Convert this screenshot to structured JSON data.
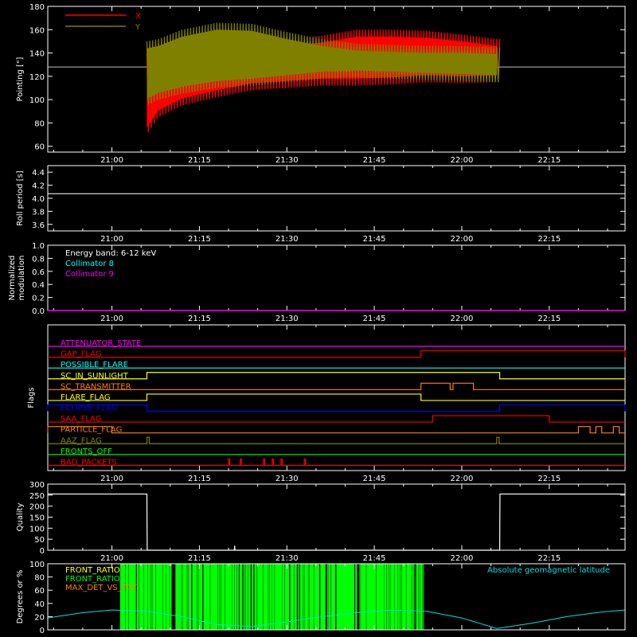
{
  "time_axis": {
    "tick_labels": [
      "21:00",
      "21:15",
      "21:30",
      "21:45",
      "22:00",
      "22:15"
    ],
    "tick_minutes": [
      0,
      15,
      30,
      45,
      60,
      75
    ],
    "range_minutes": [
      -11,
      88
    ],
    "data_start_minute": 6,
    "data_end_minute": 66.5
  },
  "colors": {
    "axis": "#ffffff",
    "x_series": "#ff0000",
    "y_series": "#808000",
    "collimator8": "#00ffff",
    "collimator9": "#ff00ff",
    "quality": "#ffffff",
    "front_ratio": "#00ff00",
    "latitude": "#00e0e0"
  },
  "chart_data": [
    {
      "id": "pointing",
      "type": "line",
      "ylabel": "Pointing [\"]",
      "ylim": [
        55,
        180
      ],
      "yticks": [
        60,
        80,
        100,
        120,
        140,
        160,
        180
      ],
      "reference_line": 128,
      "legend": [
        {
          "name": "X",
          "color": "#ff0000"
        },
        {
          "name": "Y",
          "color": "#808000"
        }
      ],
      "envelopes": [
        {
          "name": "X",
          "color": "#ff0000",
          "x": [
            6,
            8,
            12,
            18,
            24,
            30,
            36,
            42,
            48,
            54,
            60,
            66
          ],
          "upper": [
            140,
            148,
            150,
            152,
            150,
            152,
            155,
            160,
            160,
            159,
            156,
            152
          ],
          "lower": [
            70,
            85,
            95,
            102,
            108,
            110,
            112,
            112,
            113,
            115,
            114,
            115
          ]
        },
        {
          "name": "Y",
          "color": "#808000",
          "x": [
            6,
            8,
            12,
            18,
            24,
            30,
            36,
            42,
            48,
            54,
            60,
            66
          ],
          "upper": [
            150,
            152,
            160,
            166,
            165,
            158,
            152,
            148,
            147,
            146,
            146,
            145
          ],
          "lower": [
            95,
            100,
            105,
            110,
            112,
            115,
            118,
            119,
            118,
            117,
            116,
            115
          ]
        }
      ]
    },
    {
      "id": "roll_period",
      "type": "line",
      "ylabel": "Roll period [s]",
      "ylim": [
        3.5,
        4.5
      ],
      "yticks": [
        3.6,
        3.8,
        4.0,
        4.2,
        4.4
      ],
      "x": [
        -11,
        88
      ],
      "values": [
        4.07,
        4.07
      ]
    },
    {
      "id": "modulation",
      "type": "line",
      "ylabel": "Normalized modulation",
      "ylim": [
        0,
        1
      ],
      "yticks": [
        0.0,
        0.2,
        0.4,
        0.6,
        0.8,
        1.0
      ],
      "legend": [
        {
          "name": "Energy band: 6-12 keV",
          "color": "#ffffff"
        },
        {
          "name": "Collimator 8",
          "color": "#00ffff"
        },
        {
          "name": "Collimator 9",
          "color": "#ff00ff"
        }
      ],
      "x": [
        -11,
        88
      ],
      "values": [
        0,
        0
      ]
    },
    {
      "id": "flags",
      "type": "line",
      "ylabel": "Flags",
      "flags": [
        {
          "name": "ATTENUATOR_STATE",
          "color": "#ff00ff",
          "segments": []
        },
        {
          "name": "GAP_FLAG",
          "color": "#ff0000",
          "segments": [
            [
              53,
              88
            ]
          ]
        },
        {
          "name": "POSSIBLE_FLARE",
          "color": "#00ffff",
          "segments": []
        },
        {
          "name": "SC_IN_SUNLIGHT",
          "color": "#ffff00",
          "segments": [
            [
              6,
              66.5
            ]
          ]
        },
        {
          "name": "SC_TRANSMITTER",
          "color": "#ff8000",
          "segments": [
            [
              53,
              58
            ],
            [
              58.5,
              62
            ]
          ]
        },
        {
          "name": "FLARE_FLAG",
          "color": "#ffff00",
          "segments": [
            [
              6,
              53
            ]
          ]
        },
        {
          "name": "ECLIPSE_FLAG",
          "color": "#0000ff",
          "segments": [
            [
              -11,
              6
            ],
            [
              66.5,
              88
            ]
          ]
        },
        {
          "name": "SAA_FLAG",
          "color": "#ff0000",
          "segments": [
            [
              55,
              75
            ]
          ]
        },
        {
          "name": "PARTICLE_FLAG",
          "color": "#ff8000",
          "segments": [
            [
              -11,
              0
            ],
            [
              80,
              82
            ],
            [
              83,
              84
            ],
            [
              86,
              87
            ]
          ]
        },
        {
          "name": "AAZ_FLAG",
          "color": "#808000",
          "segments": [
            [
              6,
              6.4
            ],
            [
              66,
              66.4
            ]
          ]
        },
        {
          "name": "FRONTS_OFF",
          "color": "#00ff00",
          "segments": []
        },
        {
          "name": "BAD_PACKETS",
          "color": "#ff0000",
          "segments": [
            [
              20,
              20.2
            ],
            [
              22,
              22.2
            ],
            [
              26,
              26.2
            ],
            [
              27.5,
              27.7
            ],
            [
              29,
              29.2
            ],
            [
              33,
              33.2
            ]
          ]
        }
      ]
    },
    {
      "id": "quality",
      "type": "line",
      "ylabel": "Quality",
      "ylim": [
        0,
        300
      ],
      "yticks": [
        0,
        50,
        100,
        150,
        200,
        250,
        300
      ],
      "x": [
        -11,
        6,
        6.05,
        21,
        21.05,
        21.1,
        66.5,
        66.55,
        88
      ],
      "values": [
        255,
        255,
        0,
        0,
        20,
        0,
        0,
        255,
        255
      ]
    },
    {
      "id": "front_ratio",
      "type": "area",
      "ylabel": "Degrees or %",
      "ylim": [
        0,
        100
      ],
      "yticks": [
        0,
        20,
        40,
        60,
        80,
        100
      ],
      "legend": [
        {
          "name": "FRONT_RATIO",
          "color": "#ffff00"
        },
        {
          "name": "FRONT_RATIO_...",
          "color": "#00ff00"
        },
        {
          "name": "MAX_DET_VS_TOT",
          "color": "#ff8000"
        }
      ],
      "annotation": "Absolute geomagnetic latitude",
      "green_span": [
        1.5,
        53.5
      ],
      "latitude_x": [
        -11,
        -5,
        0,
        6,
        12,
        18,
        24,
        30,
        36,
        42,
        48,
        54,
        60,
        66,
        72,
        78,
        84,
        88
      ],
      "latitude_y": [
        18,
        26,
        30,
        28,
        20,
        8,
        5,
        12,
        20,
        26,
        30,
        28,
        18,
        2,
        10,
        20,
        27,
        30
      ]
    }
  ]
}
